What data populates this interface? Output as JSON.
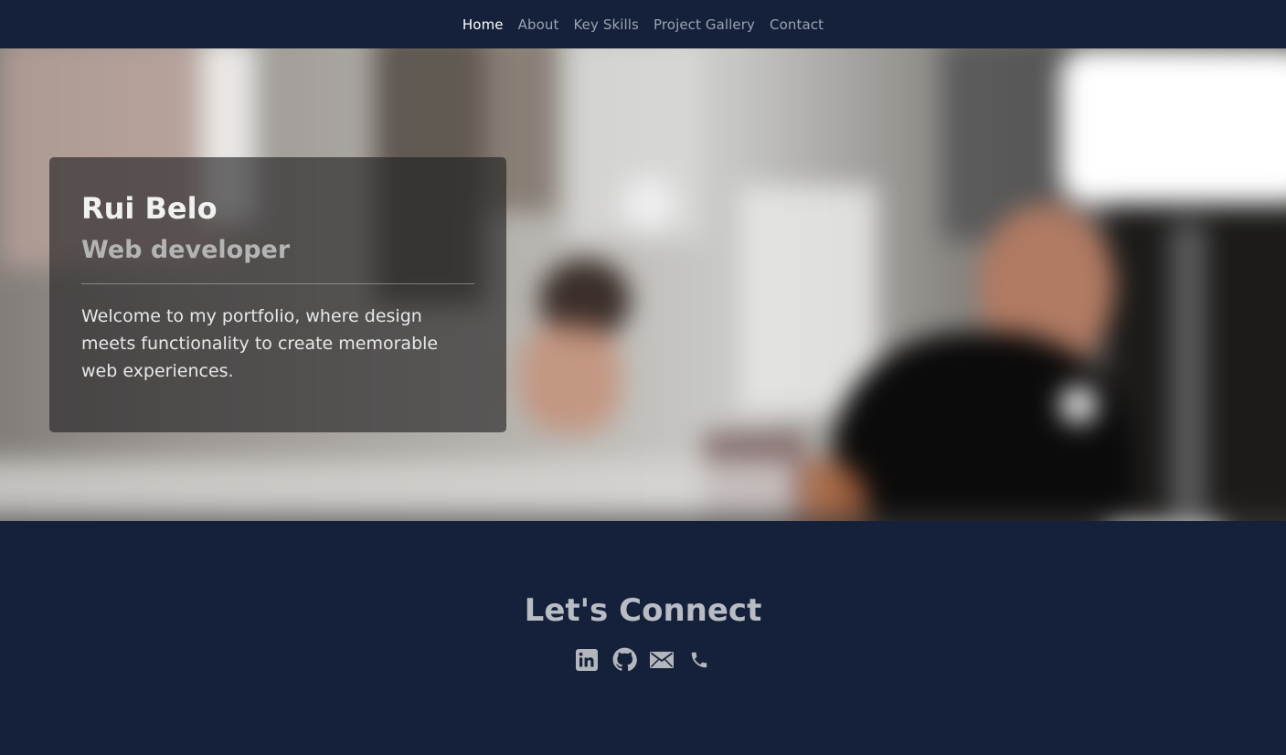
{
  "nav": {
    "items": [
      {
        "label": "Home",
        "active": true
      },
      {
        "label": "About",
        "active": false
      },
      {
        "label": "Key Skills",
        "active": false
      },
      {
        "label": "Project Gallery",
        "active": false
      },
      {
        "label": "Contact",
        "active": false
      }
    ]
  },
  "hero": {
    "name": "Rui Belo",
    "role": "Web developer",
    "text": "Welcome to my portfolio, where design meets functionality to create memorable web experiences."
  },
  "connect": {
    "title": "Let's Connect",
    "icons": [
      "linkedin-icon",
      "github-icon",
      "email-icon",
      "phone-icon"
    ]
  },
  "colors": {
    "background": "#15213a",
    "nav_active": "#ffffff",
    "nav_inactive": "#9aa3b2",
    "icon": "#b3b6bc"
  }
}
